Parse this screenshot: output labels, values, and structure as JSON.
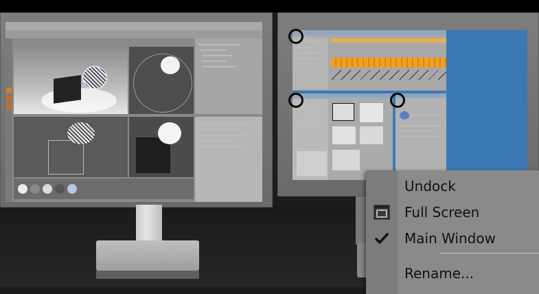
{
  "context_menu": {
    "items": [
      {
        "label": "Undock",
        "icon": "none"
      },
      {
        "label": "Full Screen",
        "icon": "fullscreen-icon"
      },
      {
        "label": "Main Window",
        "icon": "checkmark-icon",
        "checked": true
      },
      {
        "label": "Rename...",
        "icon": "none"
      }
    ]
  },
  "colors": {
    "menu_bg": "#8a8a8a",
    "menu_gutter": "#7c7c7c",
    "desktop_blue": "#3c78b4",
    "timeline_orange": "#f0a020"
  }
}
